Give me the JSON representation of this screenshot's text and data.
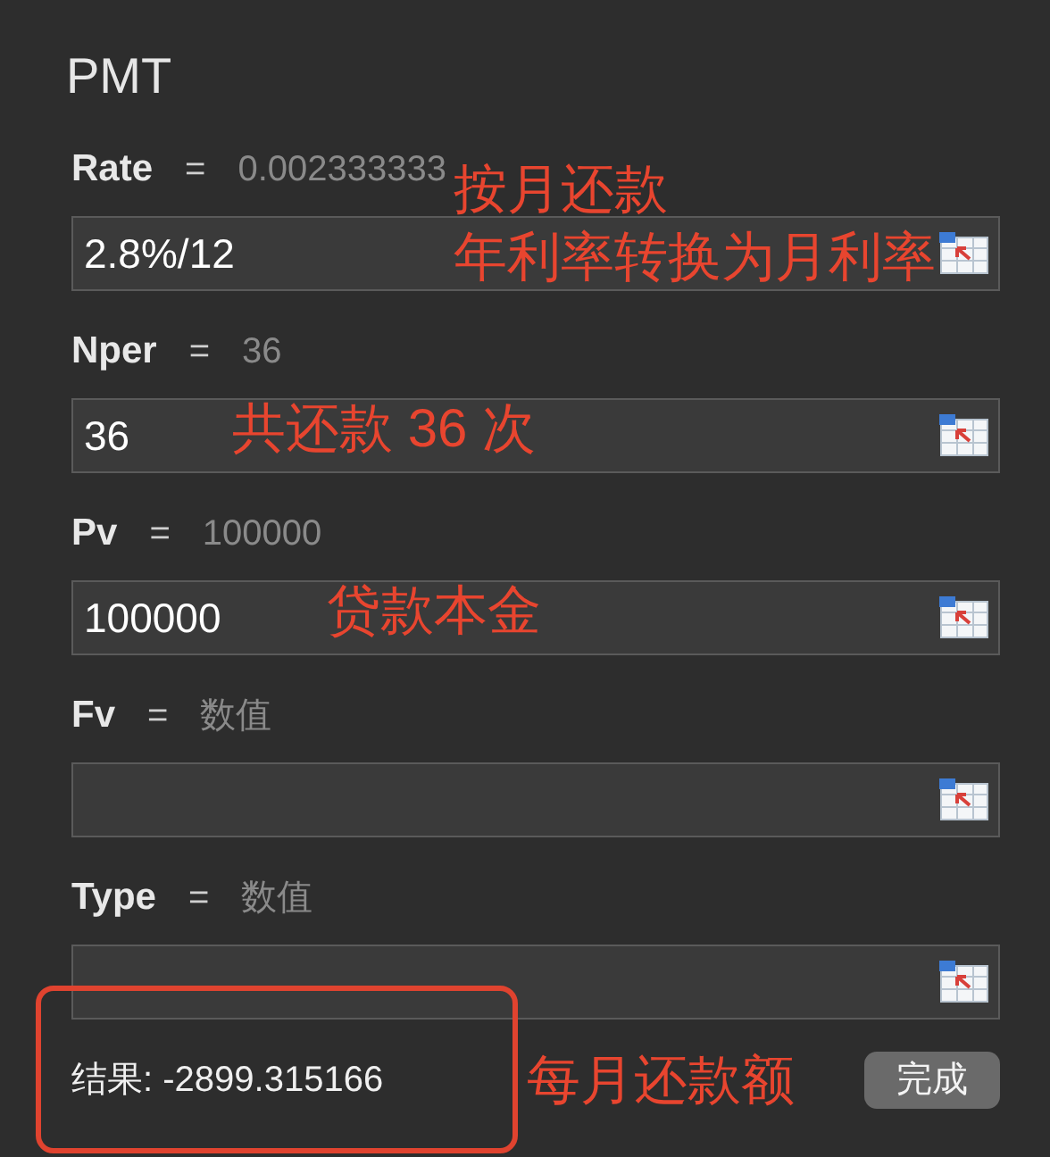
{
  "title": "PMT",
  "arguments": [
    {
      "name": "Rate",
      "value": "0.002333333",
      "input": "2.8%/12",
      "annotation": [
        "按月还款",
        "年利率转换为月利率"
      ]
    },
    {
      "name": "Nper",
      "value": "36",
      "input": "36",
      "annotation": [
        "共还款 36 次"
      ]
    },
    {
      "name": "Pv",
      "value": "100000",
      "input": "100000",
      "annotation": [
        "贷款本金"
      ]
    },
    {
      "name": "Fv",
      "value": "数值"
    },
    {
      "name": "Type",
      "value": "数值"
    }
  ],
  "equals": "=",
  "result": "结果: -2899.315166",
  "result_annotation": "每月还款额",
  "done_button": "完成"
}
